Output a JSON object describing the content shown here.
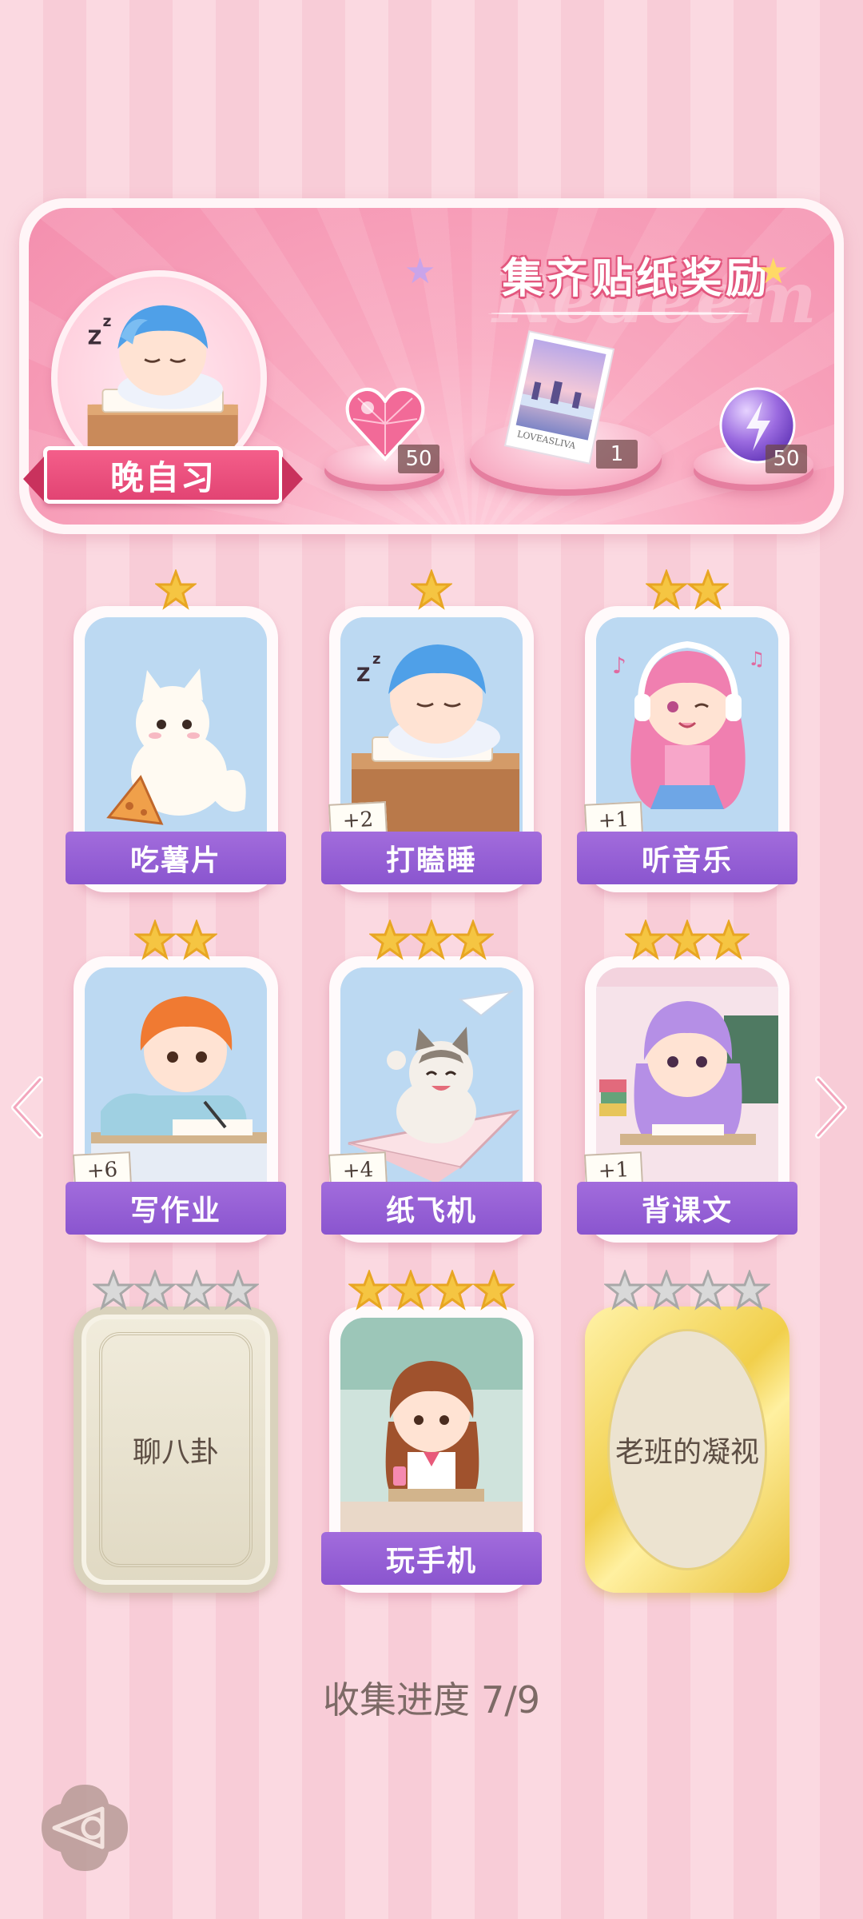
{
  "banner": {
    "title": "集齐贴纸奖励",
    "watermark": "Redeem",
    "theme_label": "晚自习",
    "rewards": [
      {
        "icon": "heart-gem-icon",
        "count": "50"
      },
      {
        "icon": "photo-card-icon",
        "count": "1",
        "caption": "LOVEASLIVA"
      },
      {
        "icon": "energy-orb-icon",
        "count": "50"
      }
    ]
  },
  "stickers": [
    {
      "label": "吃薯片",
      "stars": 1,
      "bonus": "",
      "state": "collected"
    },
    {
      "label": "打瞌睡",
      "stars": 1,
      "bonus": "+2",
      "state": "collected"
    },
    {
      "label": "听音乐",
      "stars": 2,
      "bonus": "+1",
      "state": "collected"
    },
    {
      "label": "写作业",
      "stars": 2,
      "bonus": "+6",
      "state": "collected"
    },
    {
      "label": "纸飞机",
      "stars": 3,
      "bonus": "+4",
      "state": "collected"
    },
    {
      "label": "背课文",
      "stars": 3,
      "bonus": "+1",
      "state": "collected"
    },
    {
      "label": "聊八卦",
      "stars": 4,
      "bonus": "",
      "state": "locked"
    },
    {
      "label": "玩手机",
      "stars": 4,
      "bonus": "",
      "state": "collected"
    },
    {
      "label": "老班的凝视",
      "stars": 4,
      "bonus": "",
      "state": "locked-gold"
    }
  ],
  "progress": {
    "label": "收集进度",
    "value": "7/9"
  },
  "colors": {
    "accent_purple": "#8a55cf",
    "ribbon_pink": "#e24473",
    "star_gold": "#f5c542",
    "star_gray": "#c9c9c9"
  }
}
